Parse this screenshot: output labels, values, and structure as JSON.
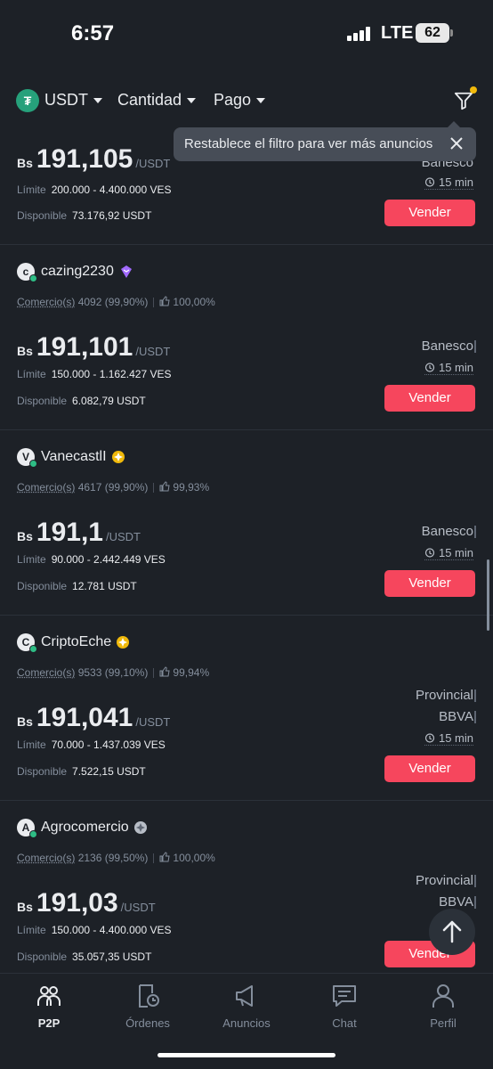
{
  "status": {
    "time": "6:57",
    "network": "LTE",
    "battery": "62"
  },
  "filters": {
    "coin": "USDT",
    "amount": "Cantidad",
    "payment": "Pago"
  },
  "tooltip": {
    "text": "Restablece el filtro para ver más anuncios"
  },
  "labels": {
    "trades": "Comercio(s)",
    "limit": "Límite",
    "available": "Disponible",
    "per_unit": "/USDT",
    "currency": "Bs",
    "sell": "Vender"
  },
  "ads": [
    {
      "price": "191,105",
      "limit": "200.000 - 4.400.000 VES",
      "available": "73.176,92 USDT",
      "payments": [
        "Banesco"
      ],
      "time": "15 min"
    },
    {
      "avatar": "c",
      "name": "cazing2230",
      "badge": "purple",
      "trades": "4092 (99,90%)",
      "rating": "100,00%",
      "price": "191,101",
      "limit": "150.000 - 1.162.427 VES",
      "available": "6.082,79 USDT",
      "payments": [
        "Banesco"
      ],
      "time": "15 min"
    },
    {
      "avatar": "V",
      "name": "VanecastlI",
      "badge": "gold",
      "trades": "4617 (99,90%)",
      "rating": "99,93%",
      "price": "191,1",
      "limit": "90.000 - 2.442.449 VES",
      "available": "12.781 USDT",
      "payments": [
        "Banesco"
      ],
      "time": "15 min"
    },
    {
      "avatar": "C",
      "name": "CriptoEche",
      "badge": "gold",
      "trades": "9533 (99,10%)",
      "rating": "99,94%",
      "price": "191,041",
      "limit": "70.000 - 1.437.039 VES",
      "available": "7.522,15 USDT",
      "payments": [
        "Provincial",
        "BBVA"
      ],
      "time": "15 min"
    },
    {
      "avatar": "A",
      "name": "Agrocomercio",
      "badge": "silver",
      "trades": "2136 (99,50%)",
      "rating": "100,00%",
      "price": "191,03",
      "limit": "150.000 - 4.400.000 VES",
      "available": "35.057,35 USDT",
      "payments": [
        "Provincial",
        "BBVA"
      ],
      "time": ""
    }
  ],
  "nav": [
    {
      "label": "P2P",
      "icon": "p2p-icon",
      "active": true
    },
    {
      "label": "Órdenes",
      "icon": "orders-icon",
      "active": false
    },
    {
      "label": "Anuncios",
      "icon": "megaphone-icon",
      "active": false
    },
    {
      "label": "Chat",
      "icon": "chat-icon",
      "active": false
    },
    {
      "label": "Perfil",
      "icon": "profile-icon",
      "active": false
    }
  ],
  "colors": {
    "background": "#1d2127",
    "sell": "#f6465d",
    "accent": "#f0b90b",
    "online": "#2ebd85",
    "muted": "#848e9c"
  }
}
